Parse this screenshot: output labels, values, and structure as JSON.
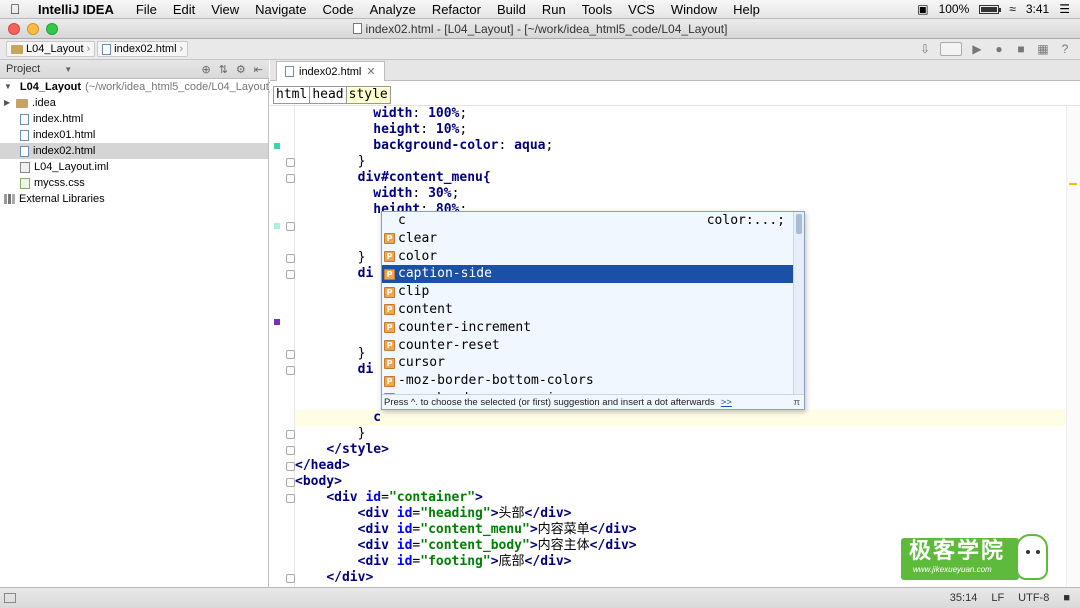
{
  "menubar": {
    "app": "IntelliJ IDEA",
    "items": [
      "File",
      "Edit",
      "View",
      "Navigate",
      "Code",
      "Analyze",
      "Refactor",
      "Build",
      "Run",
      "Tools",
      "VCS",
      "Window",
      "Help"
    ],
    "battery": "100%",
    "time": "3:41"
  },
  "window": {
    "title": "index02.html - [L04_Layout] - [~/work/idea_html5_code/L04_Layout]"
  },
  "nav": {
    "crumbs": [
      "L04_Layout",
      "index02.html"
    ]
  },
  "project_panel": {
    "title": "Project",
    "root_name": "L04_Layout",
    "root_path": "(~/work/idea_html5_code/L04_Layout)",
    "items": [
      ".idea",
      "index.html",
      "index01.html",
      "index02.html",
      "L04_Layout.iml",
      "mycss.css"
    ],
    "external": "External Libraries"
  },
  "editor": {
    "tab": "index02.html",
    "tag_breadcrumbs": [
      "html",
      "head",
      "style"
    ]
  },
  "code": {
    "l1_prop": "width",
    "l1_val": "100%",
    "l2_prop": "height",
    "l2_val": "10%",
    "l3_prop": "background-color",
    "l3_val": "aqua",
    "l5_sel": "div#content_menu{",
    "l6_prop": "width",
    "l6_val": "30%",
    "l7_prop": "height",
    "l7_val": "80%",
    "l_div": "di",
    "typed": "c",
    "close_style": "</style>",
    "close_head": "</head>",
    "body_open": "<body>",
    "div_container_id": "\"container\"",
    "div_heading_id": "\"heading\"",
    "div_heading_text": "头部",
    "div_menu_id": "\"content_menu\"",
    "div_menu_text": "内容菜单",
    "div_body_id": "\"content_body\"",
    "div_body_text": "内容主体",
    "div_footing_id": "\"footing\"",
    "div_footing_text": "底部",
    "div_close": "</div>"
  },
  "completion": {
    "typed": "c",
    "hint": "color:...;",
    "items": [
      "clear",
      "color",
      "caption-side",
      "clip",
      "content",
      "counter-increment",
      "counter-reset",
      "cursor",
      "-moz-border-bottom-colors",
      "-moz-border-corner-image"
    ],
    "selected_index": 2,
    "badge": "P",
    "footer": "Press ^. to choose the selected (or first) suggestion and insert a dot afterwards",
    "footer_link": ">>",
    "footer_pi": "π"
  },
  "status": {
    "position": "35:14",
    "line_sep": "LF",
    "encoding": "UTF-8"
  },
  "watermark": {
    "name": "极客学院",
    "url": "www.jikexueyuan.com"
  },
  "colors": {
    "selection": "#1a50a6",
    "brand_green": "#5dba3b",
    "current_line": "#fffde3"
  }
}
